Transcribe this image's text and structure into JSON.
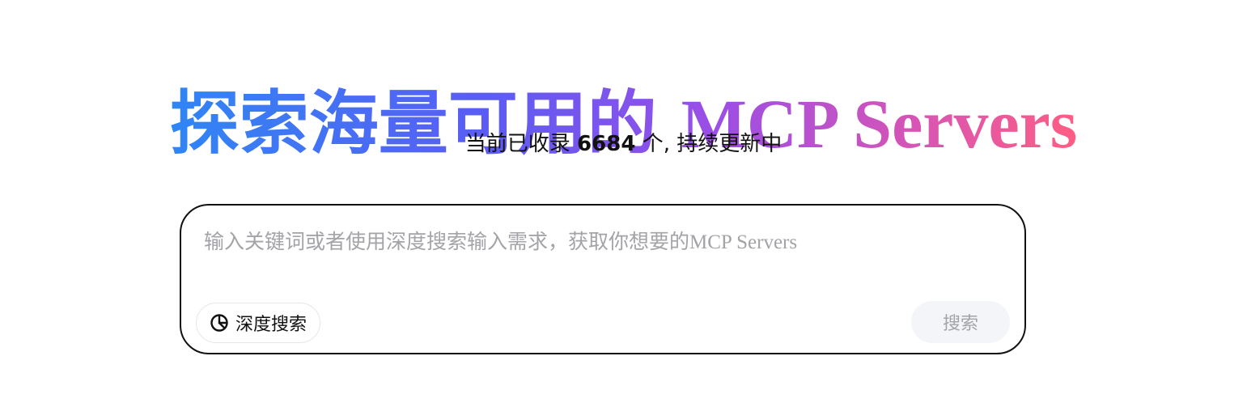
{
  "hero": {
    "title_cn": "探索海量可用的",
    "title_en": "MCP Servers"
  },
  "subtitle": {
    "prefix": "当前已收录",
    "count": "6684",
    "suffix": "个, 持续更新中"
  },
  "search": {
    "placeholder": "输入关键词或者使用深度搜索输入需求，获取你想要的MCP Servers",
    "deep_search_label": "深度搜索",
    "deep_search_icon": "deep-search-icon",
    "submit_label": "搜索"
  },
  "colors": {
    "gradient_start": "#2f86f5",
    "gradient_mid": "#9b4ee6",
    "gradient_end": "#ff5d83",
    "border": "#111111",
    "placeholder": "#a3a3a8",
    "search_button_bg": "#f4f5f8"
  }
}
